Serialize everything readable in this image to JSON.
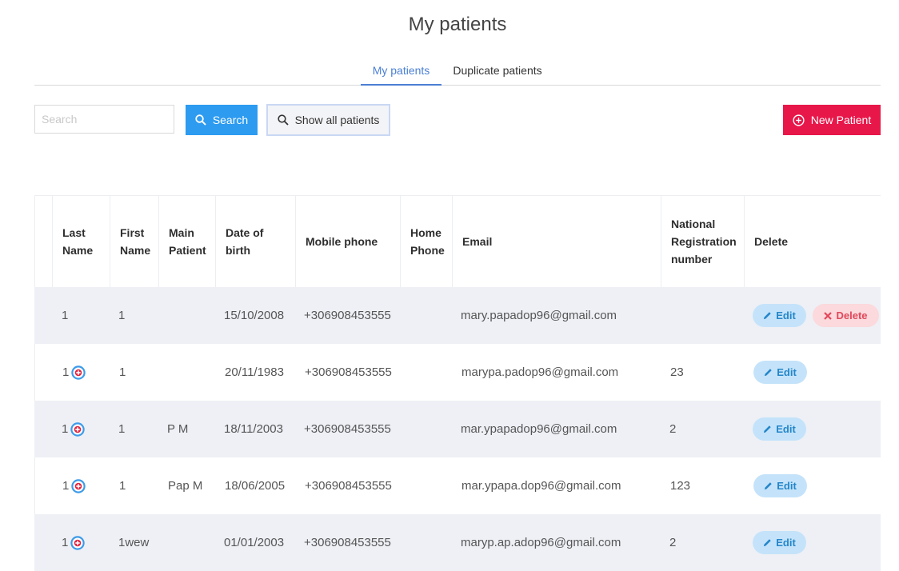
{
  "page": {
    "title": "My patients"
  },
  "tabs": [
    {
      "label": "My patients",
      "active": true
    },
    {
      "label": "Duplicate patients",
      "active": false
    }
  ],
  "toolbar": {
    "search_placeholder": "Search",
    "search_value": "",
    "search_label": "Search",
    "show_all_label": "Show all patients",
    "new_patient_label": "New Patient"
  },
  "colors": {
    "accent": "#4a7fd4",
    "search_button": "#2d9bf0",
    "new_patient_button": "#e8174a",
    "edit_button_bg": "#c4e3fa",
    "delete_button_bg": "#fbd9dc",
    "row_alt_bg": "#eef0f5"
  },
  "table": {
    "headers": {
      "last_name": "Last Name",
      "first_name": "First Name",
      "main_patient": "Main Patient",
      "dob": "Date of birth",
      "mobile": "Mobile phone",
      "home": "Home Phone",
      "email": "Email",
      "national_reg": "National Registration number",
      "delete": "Delete"
    },
    "edit_label": "Edit",
    "delete_label": "Delete",
    "rows": [
      {
        "last_name": "1",
        "main_icon": false,
        "first_name": "1",
        "main_patient": "",
        "dob": "15/10/2008",
        "mobile": "+306908453555",
        "home": "",
        "email": "mary.papadop96@gmail.com",
        "national_reg": "",
        "can_delete": true
      },
      {
        "last_name": "1",
        "main_icon": true,
        "first_name": "1",
        "main_patient": "",
        "dob": "20/11/1983",
        "mobile": "+306908453555",
        "home": "",
        "email": "marypa.padop96@gmail.com",
        "national_reg": "23",
        "can_delete": false
      },
      {
        "last_name": "1",
        "main_icon": true,
        "first_name": "1",
        "main_patient": "P M",
        "dob": "18/11/2003",
        "mobile": "+306908453555",
        "home": "",
        "email": "mar.ypapadop96@gmail.com",
        "national_reg": "2",
        "can_delete": false
      },
      {
        "last_name": "1",
        "main_icon": true,
        "first_name": "1",
        "main_patient": "Pap M",
        "dob": "18/06/2005",
        "mobile": "+306908453555",
        "home": "",
        "email": "mar.ypapa.dop96@gmail.com",
        "national_reg": "123",
        "can_delete": false
      },
      {
        "last_name": "1",
        "main_icon": true,
        "first_name": "1wew",
        "main_patient": "",
        "dob": "01/01/2003",
        "mobile": "+306908453555",
        "home": "",
        "email": "maryp.ap.adop96@gmail.com",
        "national_reg": "2",
        "can_delete": false
      }
    ]
  }
}
